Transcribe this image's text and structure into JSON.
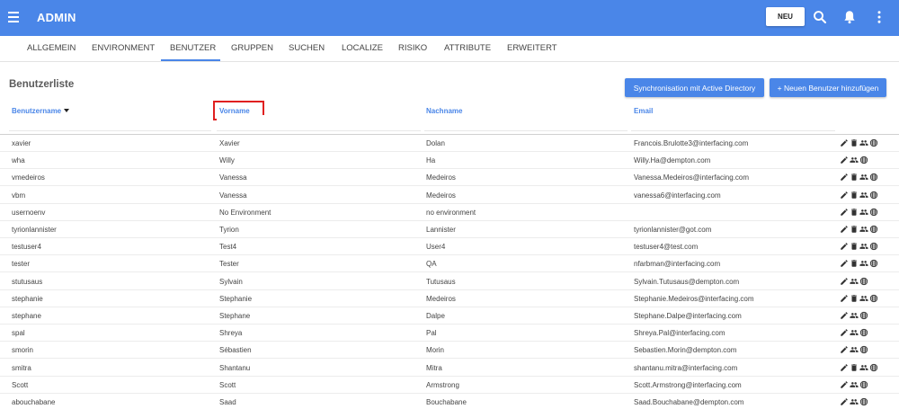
{
  "header": {
    "app_title": "ADMIN",
    "new_label": "NEU"
  },
  "colors": {
    "primary": "#4a86e8",
    "highlight_box": "#e02020"
  },
  "tabs": [
    {
      "label": "ALLGEMEIN"
    },
    {
      "label": "ENVIRONMENT"
    },
    {
      "label": "BENUTZER",
      "active": true
    },
    {
      "label": "GRUPPEN"
    },
    {
      "label": "SUCHEN"
    },
    {
      "label": "LOCALIZE"
    },
    {
      "label": "RISIKO"
    },
    {
      "label": "ATTRIBUTE"
    },
    {
      "label": "ERWEITERT"
    }
  ],
  "main": {
    "title": "Benutzerliste",
    "sync_label": "Synchronisation mit Active Directory",
    "add_label": "+ Neuen Benutzer hinzufügen"
  },
  "table": {
    "columns": [
      "Benutzername",
      "Vorname",
      "Nachname",
      "Email"
    ],
    "sort_column": "Benutzername",
    "rows": [
      {
        "username": "xavier",
        "first": "Xavier",
        "last": "Dolan",
        "email": "Francois.Brulotte3@interfacing.com",
        "icons": [
          "edit-icon",
          "delete-icon",
          "group-icon",
          "globe-icon"
        ]
      },
      {
        "username": "wha",
        "first": "Willy",
        "last": "Ha",
        "email": "Willy.Ha@dempton.com",
        "icons": [
          "edit-icon",
          "group-icon",
          "globe-icon"
        ]
      },
      {
        "username": "vmedeiros",
        "first": "Vanessa",
        "last": "Medeiros",
        "email": "Vanessa.Medeiros@interfacing.com",
        "icons": [
          "edit-icon",
          "delete-icon",
          "group-icon",
          "globe-icon"
        ]
      },
      {
        "username": "vbm",
        "first": "Vanessa",
        "last": "Medeiros",
        "email": "vanessa6@interfacing.com",
        "icons": [
          "edit-icon",
          "delete-icon",
          "group-icon",
          "globe-icon"
        ]
      },
      {
        "username": "usernoenv",
        "first": "No Environment",
        "last": "no environment",
        "email": "",
        "icons": [
          "edit-icon",
          "delete-icon",
          "group-icon",
          "globe-icon"
        ]
      },
      {
        "username": "tyrionlannister",
        "first": "Tyrion",
        "last": "Lannister",
        "email": "tyrionlannister@got.com",
        "icons": [
          "edit-icon",
          "delete-icon",
          "group-icon",
          "globe-icon"
        ]
      },
      {
        "username": "testuser4",
        "first": "Test4",
        "last": "User4",
        "email": "testuser4@test.com",
        "icons": [
          "edit-icon",
          "delete-icon",
          "group-icon",
          "globe-icon"
        ]
      },
      {
        "username": "tester",
        "first": "Tester",
        "last": "QA",
        "email": "nfarbman@interfacing.com",
        "icons": [
          "edit-icon",
          "delete-icon",
          "group-icon",
          "globe-icon"
        ]
      },
      {
        "username": "stutusaus",
        "first": "Sylvain",
        "last": "Tutusaus",
        "email": "Sylvain.Tutusaus@dempton.com",
        "icons": [
          "edit-icon",
          "group-icon",
          "globe-icon"
        ]
      },
      {
        "username": "stephanie",
        "first": "Stephanie",
        "last": "Medeiros",
        "email": "Stephanie.Medeiros@interfacing.com",
        "icons": [
          "edit-icon",
          "delete-icon",
          "group-icon",
          "globe-icon"
        ]
      },
      {
        "username": "stephane",
        "first": "Stephane",
        "last": "Dalpe",
        "email": "Stephane.Dalpe@interfacing.com",
        "icons": [
          "edit-icon",
          "group-icon",
          "globe-icon"
        ]
      },
      {
        "username": "spal",
        "first": "Shreya",
        "last": "Pal",
        "email": "Shreya.Pal@interfacing.com",
        "icons": [
          "edit-icon",
          "group-icon",
          "globe-icon"
        ]
      },
      {
        "username": "smorin",
        "first": "Sébastien",
        "last": "Morin",
        "email": "Sebastien.Morin@dempton.com",
        "icons": [
          "edit-icon",
          "group-icon",
          "globe-icon"
        ]
      },
      {
        "username": "smitra",
        "first": "Shantanu",
        "last": "Mitra",
        "email": "shantanu.mitra@interfacing.com",
        "icons": [
          "edit-icon",
          "delete-icon",
          "group-icon",
          "globe-icon"
        ]
      },
      {
        "username": "Scott",
        "first": "Scott",
        "last": "Armstrong",
        "email": "Scott.Armstrong@interfacing.com",
        "icons": [
          "edit-icon",
          "group-icon",
          "globe-icon"
        ]
      },
      {
        "username": "abouchabane",
        "first": "Saad",
        "last": "Bouchabane",
        "email": "Saad.Bouchabane@dempton.com",
        "icons": [
          "edit-icon",
          "group-icon",
          "globe-icon"
        ]
      }
    ]
  }
}
